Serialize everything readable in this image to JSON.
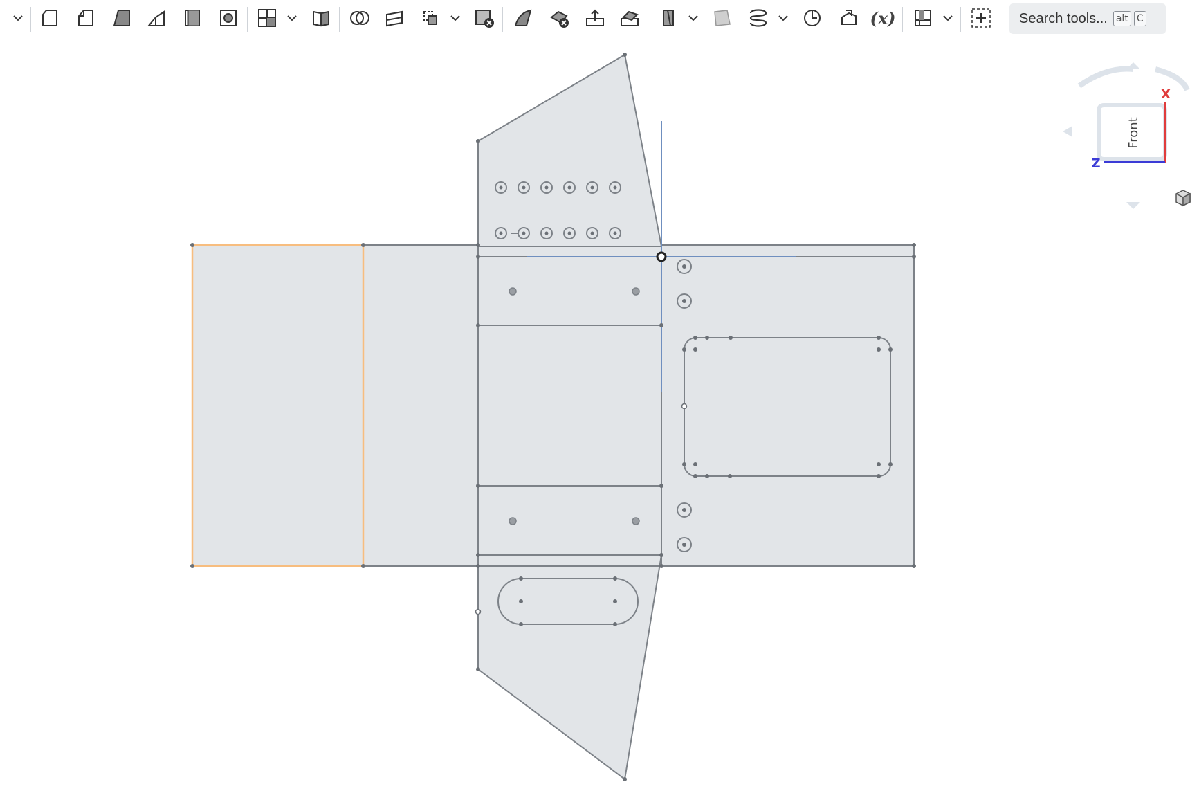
{
  "toolbar": {
    "search_label": "Search tools...",
    "search_shortcut_1": "alt",
    "search_shortcut_2": "C",
    "variable_tool_label": "(x)",
    "tools": [
      "sketch-tool",
      "extrude-tool",
      "revolve-tool",
      "sweep-tool",
      "loft-tool",
      "thicken-tool",
      "shell-tool",
      "hole-tool",
      "pattern-tool",
      "mirror-tool",
      "boolean-tool",
      "split-tool",
      "transform-tool",
      "delete-part-tool",
      "modify-fillet-tool",
      "delete-face-tool",
      "move-face-tool",
      "replace-face-tool",
      "plane-tool",
      "surface-tool",
      "helix-tool",
      "mate-connector-tool",
      "measure-tool",
      "variable-tool",
      "sheet-metal-tool",
      "add-custom-tool"
    ]
  },
  "viewcube": {
    "face_label": "Front",
    "axis_x": "X",
    "axis_z": "Z",
    "axis_x_color": "#e03c3c",
    "axis_z_color": "#3b3bd6"
  },
  "colors": {
    "face_fill": "#e2e5e8",
    "edge": "#7d8288",
    "selected_edge": "#f7bd7f",
    "origin_axis": "#6f8fbf"
  }
}
